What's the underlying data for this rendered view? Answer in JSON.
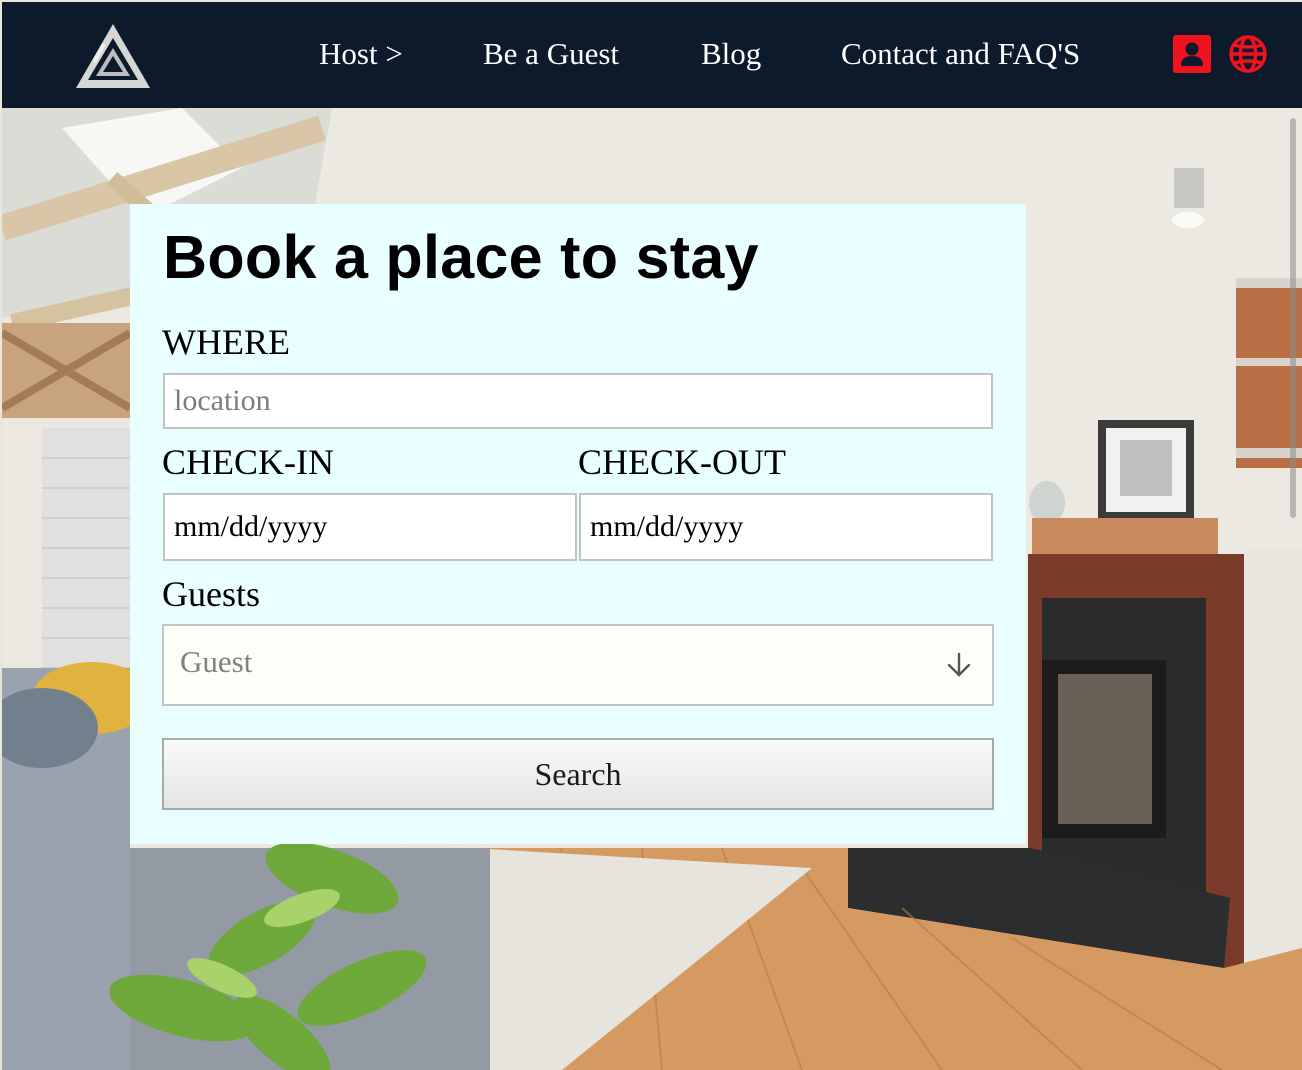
{
  "nav": {
    "links": [
      {
        "label": "Host >"
      },
      {
        "label": "Be a Guest"
      },
      {
        "label": "Blog"
      },
      {
        "label": "Contact and FAQ'S"
      }
    ],
    "icons": [
      "logo-triangle-icon",
      "user-profile-icon",
      "globe-icon"
    ],
    "background_color": "#0d1a2c",
    "icon_color": "#f0131f"
  },
  "booking": {
    "title": "Book a place to stay",
    "where_label": "WHERE",
    "location_placeholder": "location",
    "checkin_label": "CHECK-IN",
    "checkin_placeholder": "mm/dd/yyyy",
    "checkout_label": "CHECK-OUT",
    "checkout_placeholder": "mm/dd/yyyy",
    "guests_label": "Guests",
    "guests_selected": "Guest",
    "search_label": "Search",
    "card_color": "#e9fefe"
  }
}
